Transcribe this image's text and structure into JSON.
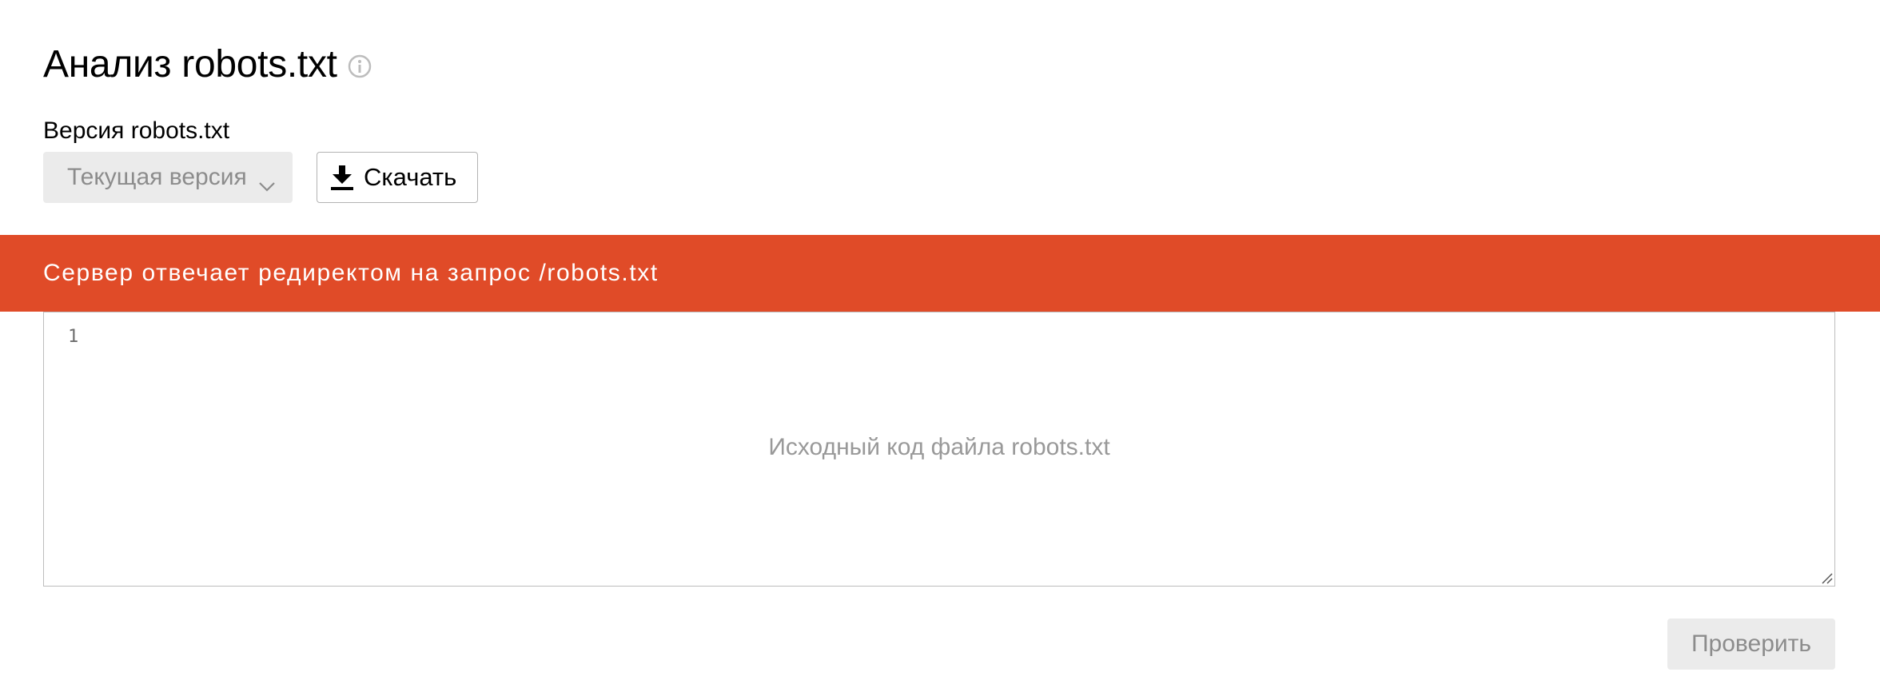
{
  "header": {
    "title": "Анализ robots.txt",
    "info_icon": "info-circle-icon"
  },
  "version": {
    "label": "Версия robots.txt",
    "selected": "Текущая версия",
    "dropdown_icon": "chevron-down-icon"
  },
  "download": {
    "label": "Скачать",
    "icon": "download-icon"
  },
  "banner": {
    "message": "Сервер отвечает редиректом на запрос /robots.txt",
    "color": "#e04b28"
  },
  "editor": {
    "line_numbers": [
      "1"
    ],
    "placeholder": "Исходный код файла robots.txt"
  },
  "actions": {
    "check_label": "Проверить"
  }
}
